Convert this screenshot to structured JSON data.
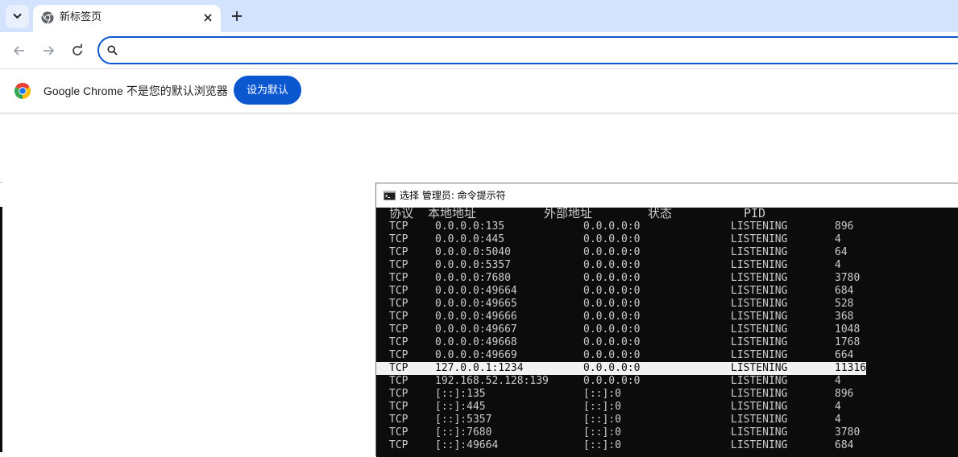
{
  "browser": {
    "tab": {
      "title": "新标签页",
      "favicon": "chrome-favicon"
    },
    "omnibox": {
      "value": "",
      "placeholder": ""
    },
    "infobar": {
      "text": "Google Chrome 不是您的默认浏览器",
      "button_label": "设为默认"
    },
    "colors": {
      "tabstrip": "#d3e3fd",
      "accent": "#0b57d0"
    }
  },
  "cmd": {
    "title": "选择 管理员: 命令提示符",
    "headers": [
      "协议",
      "本地地址",
      "外部地址",
      "状态",
      "PID"
    ],
    "rows": [
      [
        "TCP",
        "0.0.0.0:135",
        "0.0.0.0:0",
        "LISTENING",
        "896"
      ],
      [
        "TCP",
        "0.0.0.0:445",
        "0.0.0.0:0",
        "LISTENING",
        "4"
      ],
      [
        "TCP",
        "0.0.0.0:5040",
        "0.0.0.0:0",
        "LISTENING",
        "64"
      ],
      [
        "TCP",
        "0.0.0.0:5357",
        "0.0.0.0:0",
        "LISTENING",
        "4"
      ],
      [
        "TCP",
        "0.0.0.0:7680",
        "0.0.0.0:0",
        "LISTENING",
        "3780"
      ],
      [
        "TCP",
        "0.0.0.0:49664",
        "0.0.0.0:0",
        "LISTENING",
        "684"
      ],
      [
        "TCP",
        "0.0.0.0:49665",
        "0.0.0.0:0",
        "LISTENING",
        "528"
      ],
      [
        "TCP",
        "0.0.0.0:49666",
        "0.0.0.0:0",
        "LISTENING",
        "368"
      ],
      [
        "TCP",
        "0.0.0.0:49667",
        "0.0.0.0:0",
        "LISTENING",
        "1048"
      ],
      [
        "TCP",
        "0.0.0.0:49668",
        "0.0.0.0:0",
        "LISTENING",
        "1768"
      ],
      [
        "TCP",
        "0.0.0.0:49669",
        "0.0.0.0:0",
        "LISTENING",
        "664"
      ],
      [
        "TCP",
        "127.0.0.1:1234",
        "0.0.0.0:0",
        "LISTENING",
        "11316"
      ],
      [
        "TCP",
        "192.168.52.128:139",
        "0.0.0.0:0",
        "LISTENING",
        "4"
      ],
      [
        "TCP",
        "[::]:135",
        "[::]:0",
        "LISTENING",
        "896"
      ],
      [
        "TCP",
        "[::]:445",
        "[::]:0",
        "LISTENING",
        "4"
      ],
      [
        "TCP",
        "[::]:5357",
        "[::]:0",
        "LISTENING",
        "4"
      ],
      [
        "TCP",
        "[::]:7680",
        "[::]:0",
        "LISTENING",
        "3780"
      ],
      [
        "TCP",
        "[::]:49664",
        "[::]:0",
        "LISTENING",
        "684"
      ]
    ],
    "selected_row": 11
  }
}
